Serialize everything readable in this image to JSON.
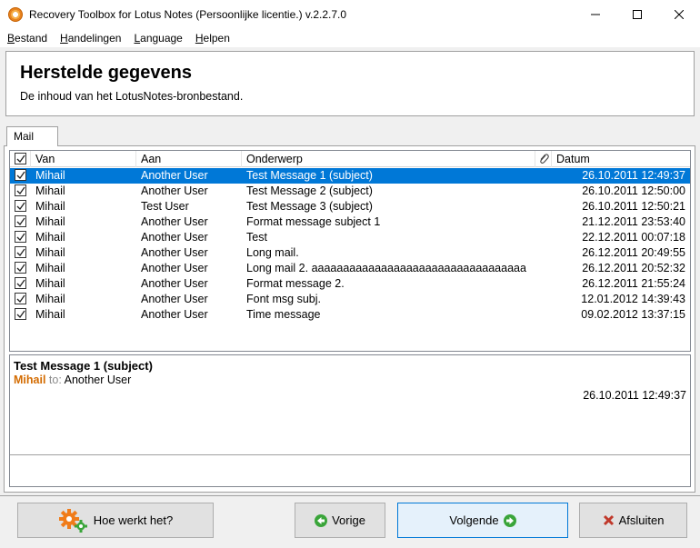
{
  "window": {
    "title": "Recovery Toolbox for Lotus Notes (Persoonlijke licentie.) v.2.2.7.0",
    "minimize_glyph": "─",
    "maximize_glyph": "☐",
    "close_glyph": "✕"
  },
  "menu": {
    "items": [
      {
        "first": "B",
        "rest": "estand"
      },
      {
        "first": "H",
        "rest": "andelingen"
      },
      {
        "first": "L",
        "rest": "anguage"
      },
      {
        "first": "H",
        "rest": "elpen"
      }
    ]
  },
  "header": {
    "title": "Herstelde gegevens",
    "subtitle": "De inhoud van het LotusNotes-bronbestand."
  },
  "tabs": [
    {
      "label": "Mail"
    }
  ],
  "grid": {
    "columns": {
      "from": "Van",
      "to": "Aan",
      "subject": "Onderwerp",
      "date": "Datum"
    },
    "rows": [
      {
        "checked": true,
        "from": "Mihail",
        "to": "Another User",
        "subject": "Test Message 1 (subject)",
        "date": "26.10.2011 12:49:37",
        "selected": true
      },
      {
        "checked": true,
        "from": "Mihail",
        "to": "Another User",
        "subject": "Test Message 2 (subject)",
        "date": "26.10.2011 12:50:00",
        "selected": false
      },
      {
        "checked": true,
        "from": "Mihail",
        "to": "Test User",
        "subject": "Test Message 3 (subject)",
        "date": "26.10.2011 12:50:21",
        "selected": false
      },
      {
        "checked": true,
        "from": "Mihail",
        "to": "Another User",
        "subject": "Format message subject 1",
        "date": "21.12.2011 23:53:40",
        "selected": false
      },
      {
        "checked": true,
        "from": "Mihail",
        "to": "Another User",
        "subject": "Test",
        "date": "22.12.2011 00:07:18",
        "selected": false
      },
      {
        "checked": true,
        "from": "Mihail",
        "to": "Another User",
        "subject": "Long mail.",
        "date": "26.12.2011 20:49:55",
        "selected": false
      },
      {
        "checked": true,
        "from": "Mihail",
        "to": "Another User",
        "subject": "Long mail 2. aaaaaaaaaaaaaaaaaaaaaaaaaaaaaaaaaa",
        "date": "26.12.2011 20:52:32",
        "selected": false
      },
      {
        "checked": true,
        "from": "Mihail",
        "to": "Another User",
        "subject": "Format message 2.",
        "date": "26.12.2011 21:55:24",
        "selected": false
      },
      {
        "checked": true,
        "from": "Mihail",
        "to": "Another User",
        "subject": "Font msg subj.",
        "date": "12.01.2012 14:39:43",
        "selected": false
      },
      {
        "checked": true,
        "from": "Mihail",
        "to": "Another User",
        "subject": "Time message",
        "date": "09.02.2012 13:37:15",
        "selected": false
      }
    ]
  },
  "preview": {
    "subject": "Test Message 1 (subject)",
    "from": "Mihail",
    "to_label": "to:",
    "to": "Another User",
    "date": "26.10.2011 12:49:37"
  },
  "buttons": {
    "help": "Hoe werkt het?",
    "prev": "Vorige",
    "next": "Volgende",
    "exit": "Afsluiten"
  },
  "colors": {
    "selection": "#0078d7",
    "sender": "#d36b00",
    "prev_icon": "#3aa53a",
    "exit_icon": "#c0392b"
  },
  "icons": {
    "app": "app-icon",
    "attachment_column": "paperclip-icon",
    "help": "gears-icon",
    "prev": "arrow-left-icon",
    "next": "arrow-right-icon",
    "exit": "x-icon"
  }
}
